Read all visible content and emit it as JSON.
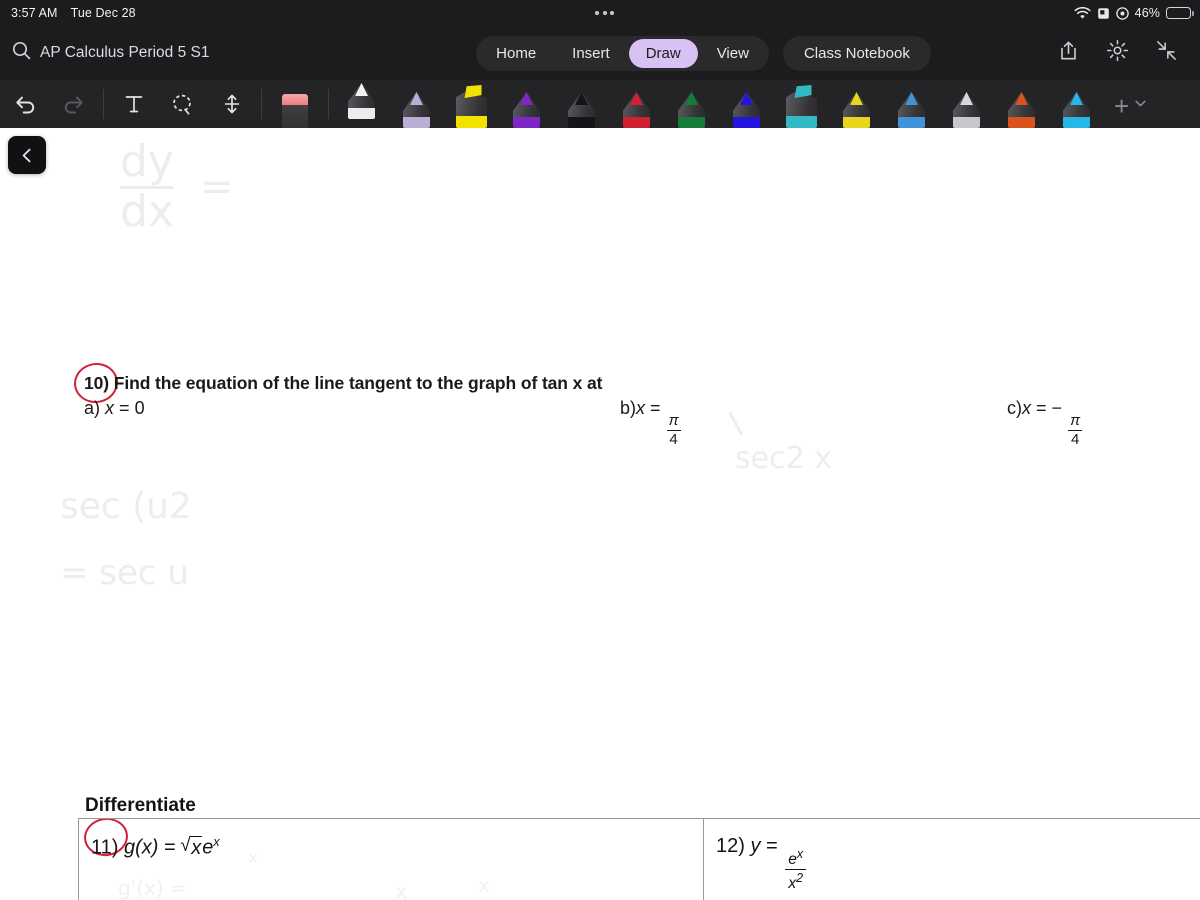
{
  "statusbar": {
    "time": "3:57 AM",
    "date": "Tue Dec 28",
    "battery_percent": "46%",
    "icons": [
      "wifi-icon",
      "alarm-icon",
      "location-icon",
      "battery-charging-icon"
    ]
  },
  "ribbon": {
    "search_icon": "search-icon",
    "notebook_title": "AP Calculus Period 5 S1",
    "tabs": [
      {
        "label": "Home",
        "selected": false
      },
      {
        "label": "Insert",
        "selected": false
      },
      {
        "label": "Draw",
        "selected": true
      },
      {
        "label": "View",
        "selected": false
      }
    ],
    "class_notebook_label": "Class Notebook",
    "right_icons": [
      "share-icon",
      "gear-icon",
      "collapse-icon"
    ],
    "accent_selected": "#d8c2f3",
    "bar_background": "#1c1c1e"
  },
  "drawbar": {
    "background": "#242426",
    "tools": [
      {
        "name": "undo-button",
        "glyph": "undo",
        "enabled": true
      },
      {
        "name": "redo-button",
        "glyph": "redo",
        "enabled": false
      },
      {
        "name": "text-tool",
        "glyph": "T",
        "enabled": true
      },
      {
        "name": "lasso-select-tool",
        "glyph": "lasso",
        "enabled": true
      },
      {
        "name": "insert-space-tool",
        "glyph": "updown-arrow",
        "enabled": true
      }
    ],
    "eraser": {
      "name": "eraser-tool",
      "top_color": "#ee7f86"
    },
    "pens": [
      {
        "name": "pen-white",
        "color": "#f2f2f2",
        "type": "pen",
        "selected": true
      },
      {
        "name": "pen-lavender",
        "color": "#b9afd6",
        "type": "pen",
        "selected": false
      },
      {
        "name": "highlighter-yellow",
        "color": "#f2e200",
        "type": "highlighter",
        "selected": false
      },
      {
        "name": "pen-purple",
        "color": "#7d28c4",
        "type": "pen",
        "selected": false
      },
      {
        "name": "pen-black",
        "color": "#151517",
        "type": "pen",
        "selected": false
      },
      {
        "name": "pen-red",
        "color": "#d1202f",
        "type": "pen",
        "selected": false
      },
      {
        "name": "pen-green",
        "color": "#167c38",
        "type": "pen",
        "selected": false
      },
      {
        "name": "pen-blue",
        "color": "#2414e0",
        "type": "pen",
        "selected": false
      },
      {
        "name": "highlighter-teal",
        "color": "#34b9c4",
        "type": "highlighter",
        "selected": false
      },
      {
        "name": "pen-yellow",
        "color": "#e7d51e",
        "type": "pen",
        "selected": false
      },
      {
        "name": "pen-lightblue",
        "color": "#3f93d6",
        "type": "pen",
        "selected": false
      },
      {
        "name": "pen-silver",
        "color": "#d9d9dc",
        "type": "pen",
        "selected": false
      },
      {
        "name": "pen-orange",
        "color": "#d9541c",
        "type": "pen",
        "selected": false
      },
      {
        "name": "pen-cyan",
        "color": "#25b8e6",
        "type": "pen",
        "selected": false
      }
    ],
    "add_pen_label": "+",
    "add_pen_chevron": "chevron-down-icon"
  },
  "canvas": {
    "back_button": "‹",
    "handwriting": {
      "dydx_numerator": "dy",
      "dydx_denominator": "dx",
      "dydx_equals": "=",
      "sec_u_line1": "sec (u",
      "sec_u_line1_sup": "2",
      "sec_u_line2": "= sec u",
      "sec2x": "sec",
      "sec2x_sup": "2",
      "sec2x_var": "x",
      "bottom_note_1": "x",
      "bottom_note_2": "g'(x) =",
      "bottom_note_3": "x",
      "bottom_note_4": "x"
    },
    "question10": {
      "number": "10)",
      "prompt": "Find the equation of the line tangent to the graph of tan x at",
      "parts": [
        {
          "label": "a)",
          "expr_var": "x",
          "eq": "=",
          "value": "0"
        },
        {
          "label": "b)",
          "expr_var": "x",
          "eq": "=",
          "frac_num": "π",
          "frac_den": "4"
        },
        {
          "label": "c)",
          "expr_var": "x",
          "eq": "=",
          "sign": "−",
          "frac_num": "π",
          "frac_den": "4"
        }
      ]
    },
    "differentiate": {
      "heading": "Differentiate",
      "items": [
        {
          "number": "11)",
          "fn": "g(x)",
          "eq": "=",
          "radicand": "x",
          "tail": "e",
          "tail_sup": "x"
        },
        {
          "number": "12)",
          "fn": "y",
          "eq": "=",
          "frac_num": "e",
          "frac_num_sup": "x",
          "frac_den": "x",
          "frac_den_sup": "2"
        }
      ]
    },
    "red_annotation_color": "#d1213b"
  }
}
